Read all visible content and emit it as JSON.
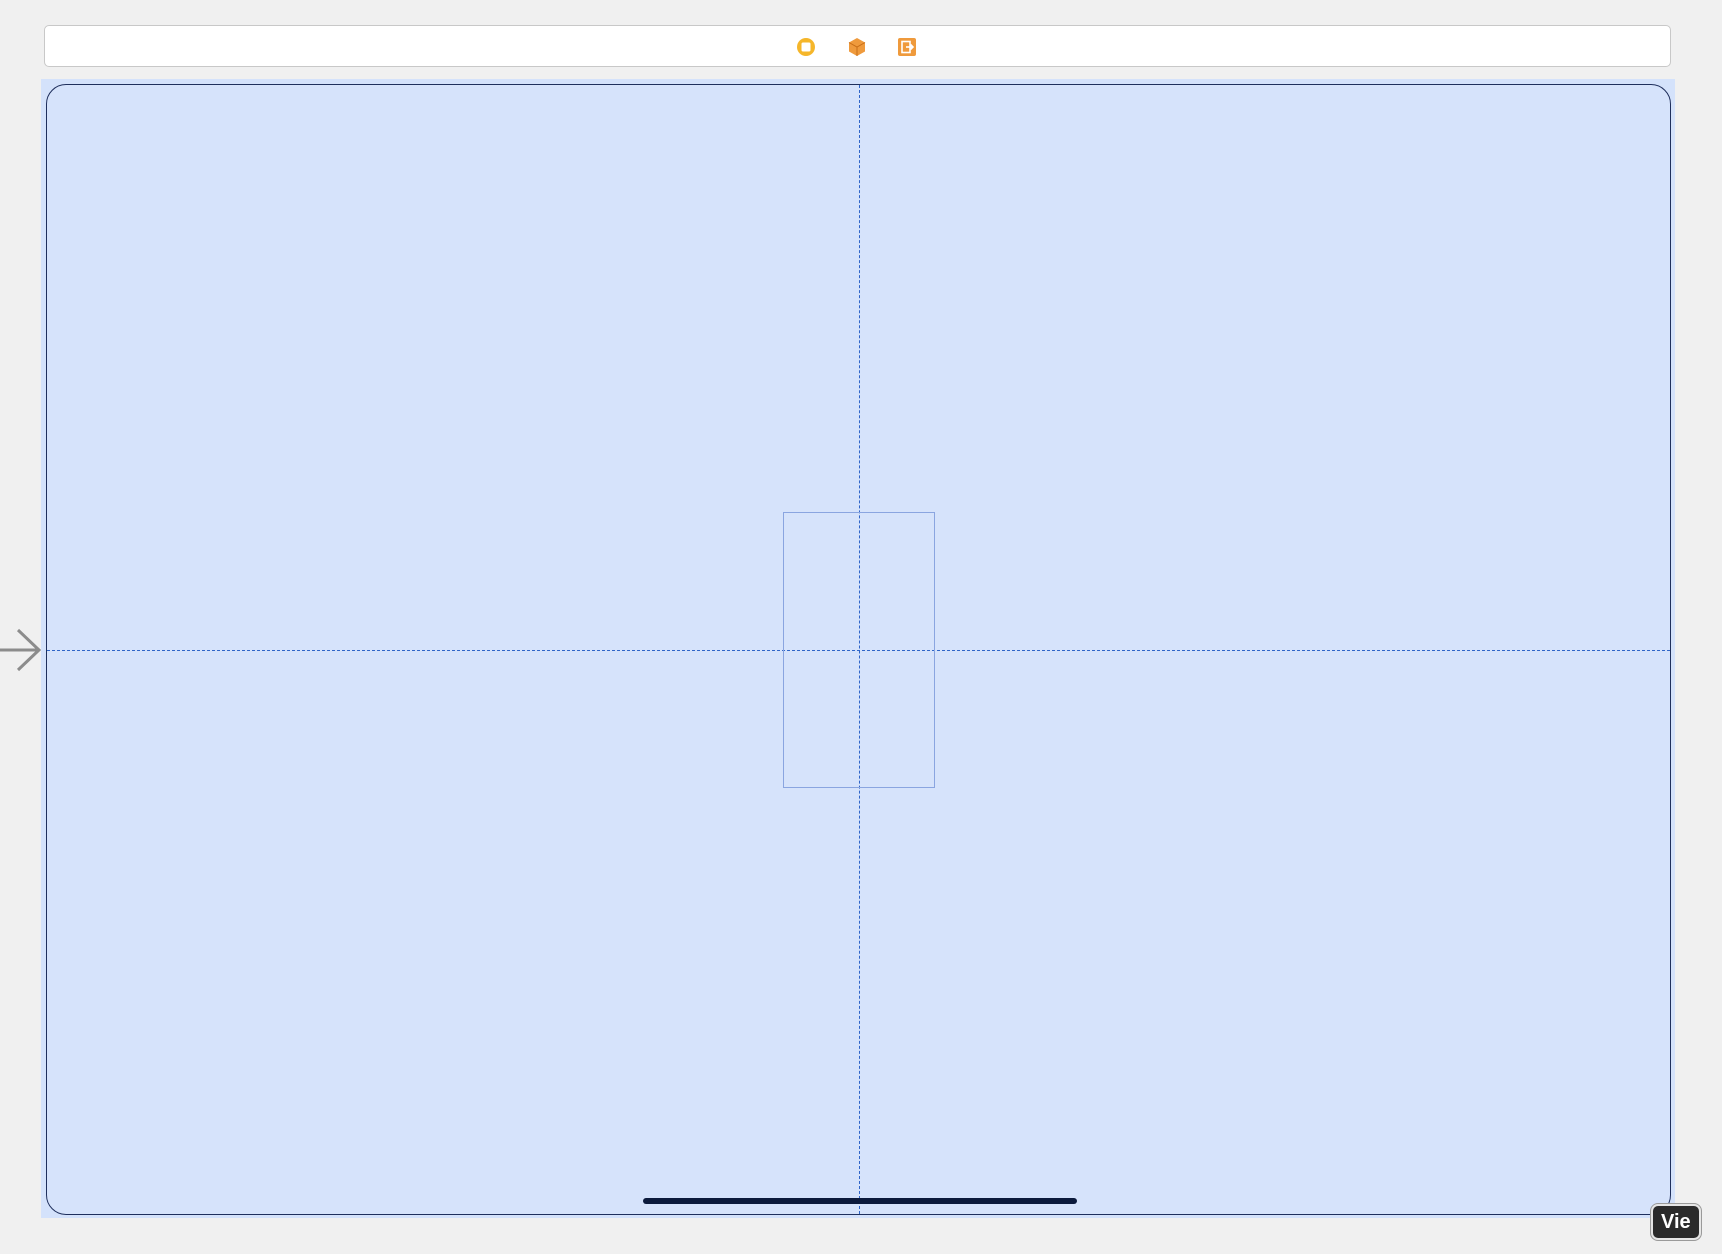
{
  "scene_dock": {
    "icons": [
      {
        "name": "view-controller-icon",
        "color": "#f5b62a"
      },
      {
        "name": "first-responder-icon",
        "color": "#ef9a3c"
      },
      {
        "name": "exit-icon",
        "color": "#ef9a3c"
      }
    ]
  },
  "canvas": {
    "selection_color": "#d4e2fb",
    "frame_border_color": "#1f2f5c",
    "guide_color": "#2f65c8",
    "entry_arrow_icon": "entry-point-arrow-icon"
  },
  "badge": {
    "label": "Vie"
  }
}
